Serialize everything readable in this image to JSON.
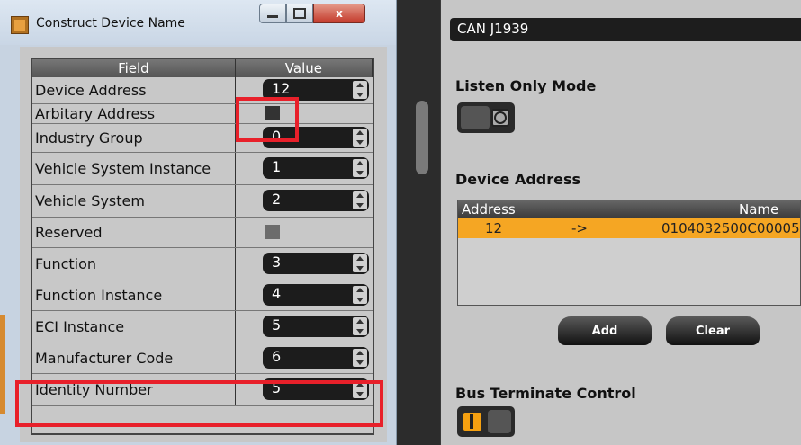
{
  "window": {
    "title": "Construct Device Name",
    "buttons": {
      "minimize": "minimize",
      "maximize": "maximize",
      "close": "x"
    }
  },
  "grid": {
    "headers": {
      "field": "Field",
      "value": "Value"
    },
    "rows": [
      {
        "field": "Device Address",
        "value": "12",
        "type": "spin"
      },
      {
        "field": "Arbitary Address",
        "value": "",
        "type": "checkbox"
      },
      {
        "field": "Industry Group",
        "value": "0",
        "type": "spin"
      },
      {
        "field": "Vehicle System Instance",
        "value": "1",
        "type": "spin"
      },
      {
        "field": "Vehicle System",
        "value": "2",
        "type": "spin"
      },
      {
        "field": "Reserved",
        "value": "",
        "type": "checkbox-disabled"
      },
      {
        "field": "Function",
        "value": "3",
        "type": "spin"
      },
      {
        "field": "Function Instance",
        "value": "4",
        "type": "spin"
      },
      {
        "field": "ECI Instance",
        "value": "5",
        "type": "spin"
      },
      {
        "field": "Manufacturer Code",
        "value": "6",
        "type": "spin"
      },
      {
        "field": "Identity Number",
        "value": "5",
        "type": "spin"
      }
    ]
  },
  "right": {
    "protocol_value": "CAN J1939",
    "listen_only_label": "Listen Only Mode",
    "device_address_label": "Device Address",
    "list": {
      "headers": {
        "address": "Address",
        "name": "Name"
      },
      "rows": [
        {
          "address": "12",
          "arrow": "->",
          "name": "0104032500C00005"
        }
      ]
    },
    "add_label": "Add",
    "clear_label": "Clear",
    "bus_terminate_label": "Bus Terminate Control",
    "toggle_on_glyph": "I"
  },
  "colors": {
    "highlight_red": "#e8202a",
    "selection_orange": "#f5a623",
    "accent_on": "#f5a010"
  }
}
